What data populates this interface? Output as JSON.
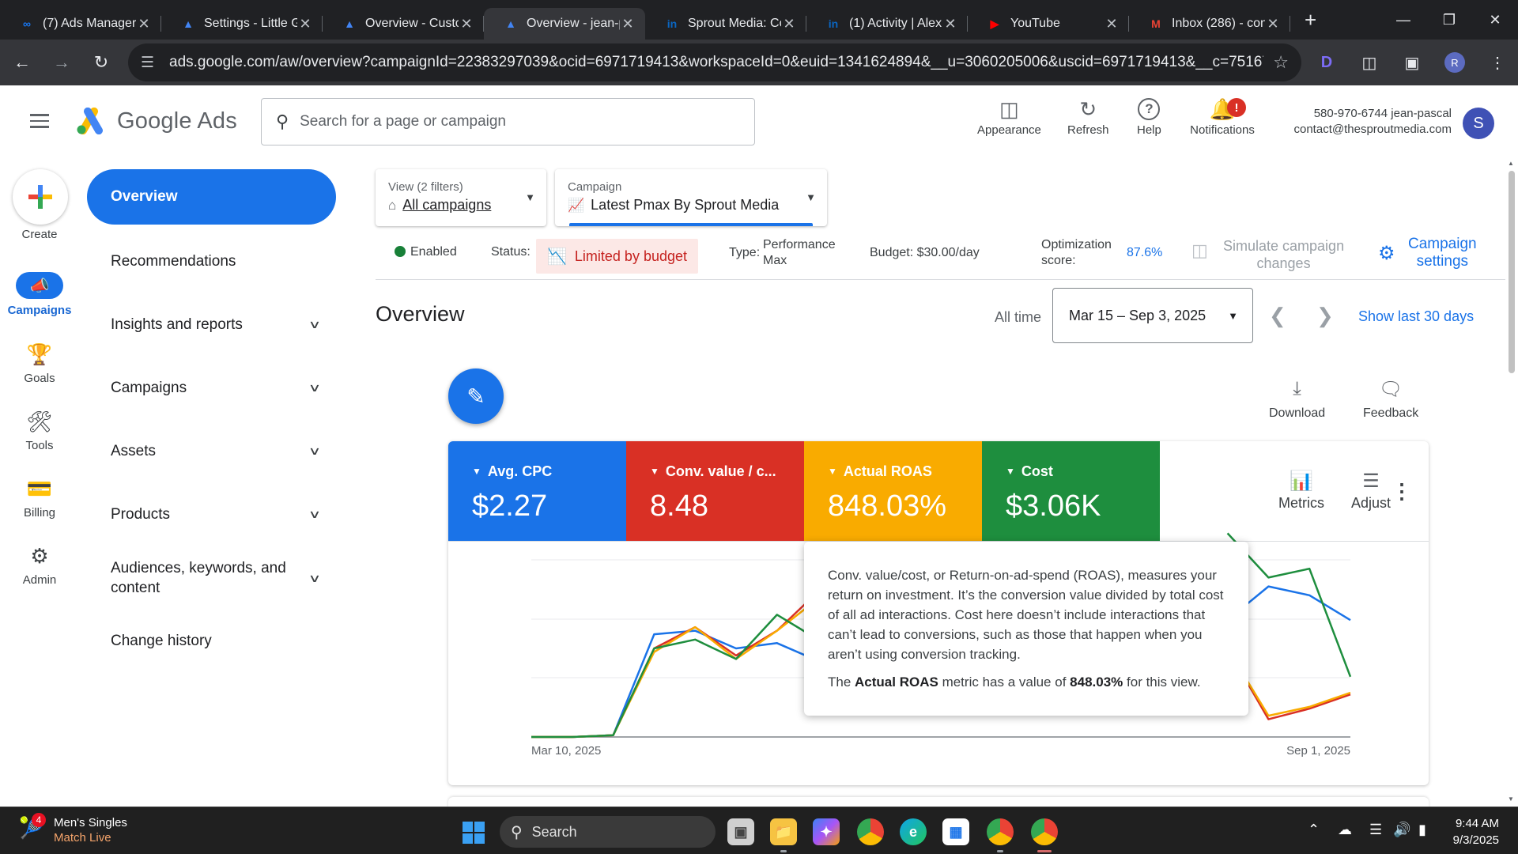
{
  "browser": {
    "tabs": [
      {
        "title": "(7) Ads Manager",
        "favicon": "meta-icon",
        "color": "#1877f2",
        "active": false
      },
      {
        "title": "Settings - Little G",
        "favicon": "google-ads-icon",
        "color": "#4285f4",
        "active": false
      },
      {
        "title": "Overview - Custo",
        "favicon": "google-ads-icon",
        "color": "#4285f4",
        "active": false
      },
      {
        "title": "Overview - jean-p",
        "favicon": "google-ads-icon",
        "color": "#4285f4",
        "active": true
      },
      {
        "title": "Sprout Media: Co",
        "favicon": "linkedin-icon",
        "color": "#0a66c2",
        "active": false
      },
      {
        "title": "(1) Activity | Alex",
        "favicon": "linkedin-icon",
        "color": "#0a66c2",
        "active": false
      },
      {
        "title": "YouTube",
        "favicon": "youtube-icon",
        "color": "#ff0000",
        "active": false
      },
      {
        "title": "Inbox (286) - cont",
        "favicon": "gmail-icon",
        "color": "#ea4335",
        "active": false
      }
    ],
    "url": "ads.google.com/aw/overview?campaignId=22383297039&ocid=6971719413&workspaceId=0&euid=1341624894&__u=3060205006&uscid=6971719413&__c=7516746637&aut...",
    "profile_initial": "R"
  },
  "header": {
    "brand": "Google Ads",
    "search_placeholder": "Search for a page or campaign",
    "tools": {
      "appearance": "Appearance",
      "refresh": "Refresh",
      "help": "Help",
      "notifications": "Notifications",
      "notification_badge": "!"
    },
    "account_line1": "580-970-6744 jean-pascal",
    "account_line2": "contact@thesproutmedia.com",
    "avatar_initial": "S"
  },
  "rail": {
    "create": "Create",
    "campaigns": "Campaigns",
    "goals": "Goals",
    "tools": "Tools",
    "billing": "Billing",
    "admin": "Admin"
  },
  "nav": {
    "overview": "Overview",
    "recommendations": "Recommendations",
    "insights": "Insights and reports",
    "campaigns": "Campaigns",
    "assets": "Assets",
    "products": "Products",
    "audiences": "Audiences, keywords, and content",
    "change_history": "Change history"
  },
  "selectors": {
    "view_label": "View (2 filters)",
    "view_value": "All campaigns",
    "campaign_label": "Campaign",
    "campaign_value": "Latest Pmax By Sprout Media"
  },
  "status": {
    "enabled": "Enabled",
    "status_label": "Status:",
    "status_value": "Limited by budget",
    "type_label": "Type:",
    "type_value_1": "Performance",
    "type_value_2": "Max",
    "budget": "Budget: $30.00/day",
    "optimization_label_1": "Optimization",
    "optimization_label_2": "score:",
    "optimization_value": "87.6%",
    "simulate_1": "Simulate campaign",
    "simulate_2": "changes",
    "campaign_settings_1": "Campaign",
    "campaign_settings_2": "settings"
  },
  "overview": {
    "title": "Overview",
    "all_time": "All time",
    "date_range": "Mar 15 – Sep 3, 2025",
    "show_last_30": "Show last 30 days",
    "download": "Download",
    "feedback": "Feedback",
    "metrics": "Metrics",
    "adjust": "Adjust"
  },
  "scorecards": [
    {
      "name": "Avg. CPC",
      "value": "$2.27",
      "color": "#1a73e8"
    },
    {
      "name": "Conv. value / c...",
      "value": "8.48",
      "color": "#d93025"
    },
    {
      "name": "Actual ROAS",
      "value": "848.03%",
      "color": "#f9ab00"
    },
    {
      "name": "Cost",
      "value": "$3.06K",
      "color": "#1e8e3e"
    }
  ],
  "chart_data": {
    "type": "line",
    "x_start_label": "Mar 10, 2025",
    "x_end_label": "Sep 1, 2025",
    "series": [
      {
        "color": "#1a73e8",
        "values": [
          0,
          0,
          0.01,
          0.58,
          0.6,
          0.5,
          0.53,
          0.43,
          0.28,
          null,
          null,
          null,
          null,
          null,
          null,
          null,
          null,
          0.66,
          0.85,
          0.8,
          0.66
        ]
      },
      {
        "color": "#d93025",
        "values": [
          0,
          0,
          0.01,
          0.5,
          0.62,
          0.46,
          0.6,
          0.82,
          1.0,
          null,
          null,
          null,
          null,
          null,
          null,
          null,
          null,
          0.5,
          0.1,
          0.16,
          0.24
        ]
      },
      {
        "color": "#f9ab00",
        "values": [
          0,
          0,
          0.01,
          0.48,
          0.62,
          0.44,
          0.6,
          0.78,
          0.97,
          null,
          null,
          null,
          null,
          null,
          null,
          null,
          null,
          0.5,
          0.12,
          0.17,
          0.25
        ]
      },
      {
        "color": "#1e8e3e",
        "values": [
          0,
          0,
          0.01,
          0.5,
          0.55,
          0.44,
          0.69,
          0.55,
          0.55,
          null,
          null,
          null,
          null,
          null,
          null,
          null,
          null,
          1.15,
          0.9,
          0.95,
          0.34
        ]
      }
    ]
  },
  "tooltip": {
    "text": "Conv. value/cost, or Return-on-ad-spend (ROAS), measures your return on investment. It’s the conversion value divided by total cost of all ad interactions. Cost here doesn’t include interactions that can’t lead to conversions, such as those that happen when you aren’t using conversion tracking.",
    "metric_prefix": "The",
    "metric_name": "Actual ROAS",
    "metric_mid": "metric has a value of",
    "metric_value": "848.03%",
    "metric_suffix": "for this view."
  },
  "taskbar": {
    "weather_badge": "4",
    "weather_line1": "Men's Singles",
    "weather_line2": "Match Live",
    "search": "Search",
    "time": "9:44 AM",
    "date": "9/3/2025"
  }
}
